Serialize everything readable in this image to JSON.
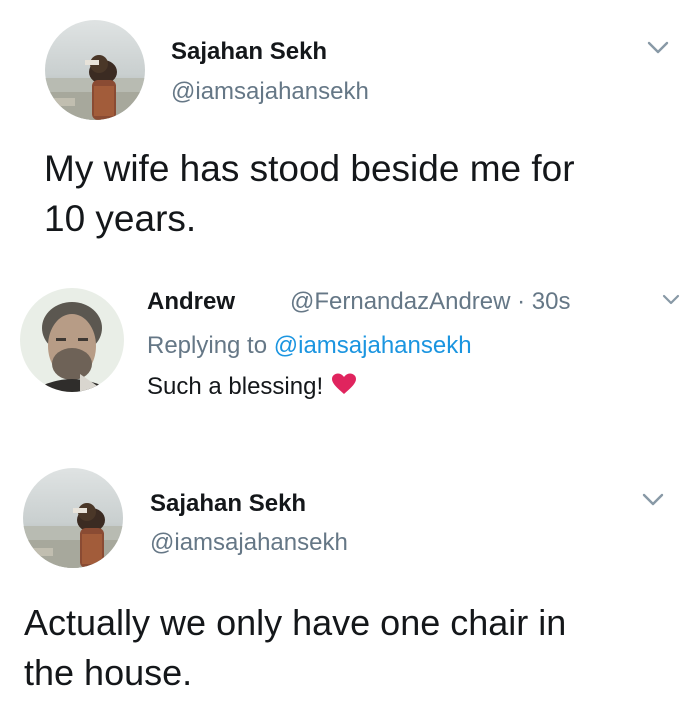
{
  "colors": {
    "text": "#14171a",
    "secondary": "#657786",
    "link": "#1b95e0",
    "heart": "#e0245e"
  },
  "tweet1": {
    "name": "Sajahan Sekh",
    "handle": "@iamsajahansekh",
    "text_line1": "My wife has stood beside me for",
    "text_line2": "10 years.",
    "avatar_icon": "profile-photo",
    "menu_icon": "chevron-down-icon"
  },
  "reply": {
    "name": "Andrew",
    "handle_time": "@FernandazAndrew · 30s",
    "replying_prefix": "Replying to",
    "replying_handle": "@iamsajahansekh",
    "text": "Such a blessing!",
    "emoji_icon": "heart-icon",
    "avatar_icon": "profile-photo",
    "menu_icon": "chevron-down-icon"
  },
  "tweet2": {
    "name": "Sajahan Sekh",
    "handle": "@iamsajahansekh",
    "text_line1": "Actually we only have one chair in",
    "text_line2": "the house.",
    "avatar_icon": "profile-photo",
    "menu_icon": "chevron-down-icon"
  }
}
